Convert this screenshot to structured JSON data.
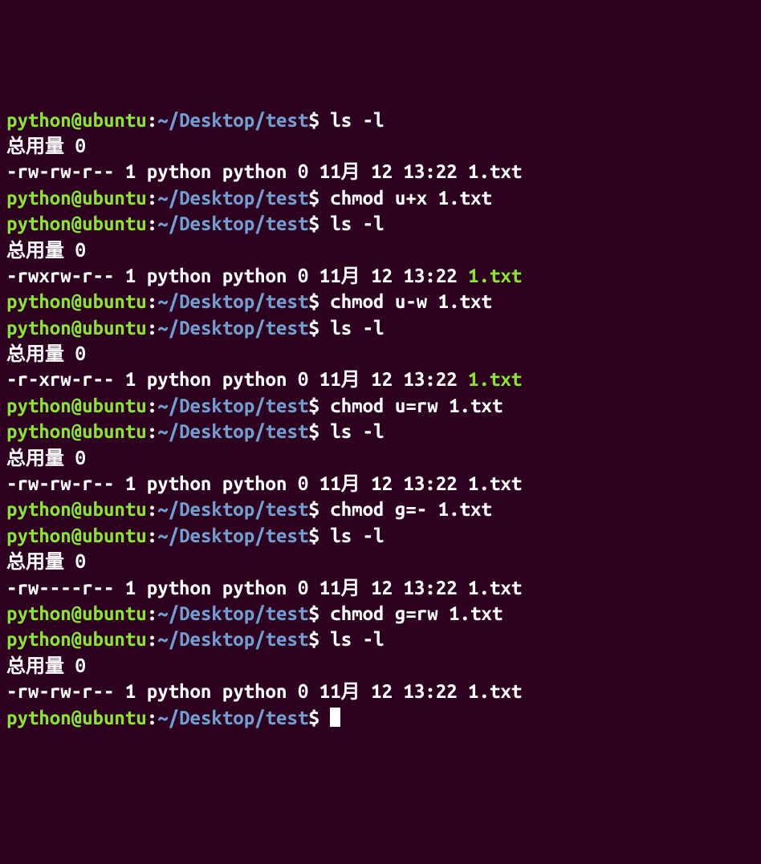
{
  "prompt": {
    "user_host": "python@ubuntu",
    "colon": ":",
    "path": "~/Desktop/test",
    "dollar": "$"
  },
  "lines": [
    {
      "type": "prompt",
      "cmd": "ls -l"
    },
    {
      "type": "output",
      "text": "总用量 0"
    },
    {
      "type": "output",
      "text": "-rw-rw-r-- 1 python python 0 11月 12 13:22 1.txt"
    },
    {
      "type": "prompt",
      "cmd": "chmod u+x 1.txt"
    },
    {
      "type": "prompt",
      "cmd": "ls -l"
    },
    {
      "type": "output",
      "text": "总用量 0"
    },
    {
      "type": "output-exec",
      "prefix": "-rwxrw-r-- 1 python python 0 11月 12 13:22 ",
      "file": "1.txt"
    },
    {
      "type": "prompt",
      "cmd": "chmod u-w 1.txt"
    },
    {
      "type": "prompt",
      "cmd": "ls -l"
    },
    {
      "type": "output",
      "text": "总用量 0"
    },
    {
      "type": "output-exec",
      "prefix": "-r-xrw-r-- 1 python python 0 11月 12 13:22 ",
      "file": "1.txt"
    },
    {
      "type": "prompt",
      "cmd": "chmod u=rw 1.txt"
    },
    {
      "type": "prompt",
      "cmd": "ls -l"
    },
    {
      "type": "output",
      "text": "总用量 0"
    },
    {
      "type": "output",
      "text": "-rw-rw-r-- 1 python python 0 11月 12 13:22 1.txt"
    },
    {
      "type": "prompt",
      "cmd": "chmod g=- 1.txt"
    },
    {
      "type": "prompt",
      "cmd": "ls -l"
    },
    {
      "type": "output",
      "text": "总用量 0"
    },
    {
      "type": "output",
      "text": "-rw----r-- 1 python python 0 11月 12 13:22 1.txt"
    },
    {
      "type": "prompt",
      "cmd": "chmod g=rw 1.txt"
    },
    {
      "type": "prompt",
      "cmd": "ls -l"
    },
    {
      "type": "output",
      "text": "总用量 0"
    },
    {
      "type": "output",
      "text": "-rw-rw-r-- 1 python python 0 11月 12 13:22 1.txt"
    },
    {
      "type": "prompt-cursor",
      "cmd": ""
    }
  ]
}
